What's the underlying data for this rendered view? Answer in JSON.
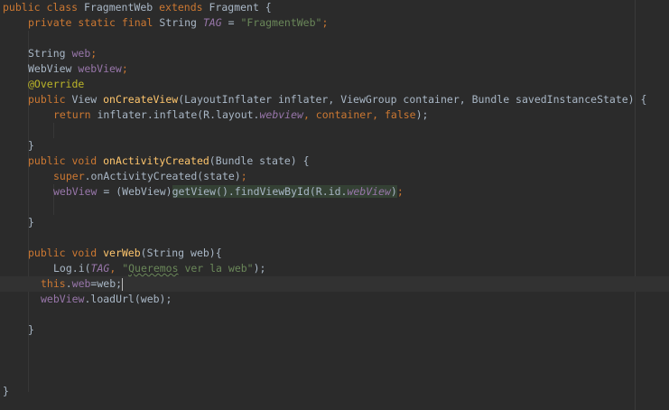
{
  "editor": {
    "lines": {
      "l1": {
        "kw1": "public class ",
        "cls": "FragmentWeb ",
        "kw2": "extends ",
        "cls2": "Fragment {"
      },
      "l2": {
        "kw": "private static final ",
        "type": "String ",
        "const": "TAG",
        "eq": " = ",
        "str": "\"FragmentWeb\"",
        "semi": ";"
      },
      "l4": {
        "type": "String ",
        "field": "web",
        "semi": ";"
      },
      "l5": {
        "type": "WebView ",
        "field": "webView",
        "semi": ";"
      },
      "l6": {
        "ann": "@Override"
      },
      "l7": {
        "kw": "public ",
        "type": "View ",
        "method": "onCreateView",
        "params": "(LayoutInflater inflater, ViewGroup container, Bundle savedInstanceState) {"
      },
      "l8": {
        "kw": "return ",
        "call": "inflater.inflate(R.layout.",
        "field": "webview",
        "mid": ", container, ",
        "kw2": "false",
        "end": ");"
      },
      "l10": {
        "brace": "}"
      },
      "l11": {
        "kw": "public void ",
        "method": "onActivityCreated",
        "params": "(Bundle state) {"
      },
      "l12": {
        "kw": "super",
        "call": ".onActivityCreated(state)",
        "semi": ";"
      },
      "l13": {
        "field": "webView",
        "mid": " = (WebView)",
        "hl": "getView().findViewById(R.id.",
        "hlfield": "webView",
        "hlend": ")",
        "semi": ";"
      },
      "l15": {
        "brace": "}"
      },
      "l17": {
        "kw": "public void ",
        "method": "verWeb",
        "params": "(String web){"
      },
      "l18": {
        "call": "Log.i(",
        "const": "TAG",
        "comma": ", ",
        "str1": "\"",
        "typo": "Queremos",
        "str2": " ver la web\"",
        "end": ");"
      },
      "l19": {
        "kw": "this",
        "dot": ".",
        "field": "web",
        "rest": "=web;"
      },
      "l20": {
        "field": "webView",
        "rest": ".loadUrl(web);"
      },
      "l22": {
        "brace": "}"
      },
      "l26": {
        "brace": "}"
      }
    }
  }
}
